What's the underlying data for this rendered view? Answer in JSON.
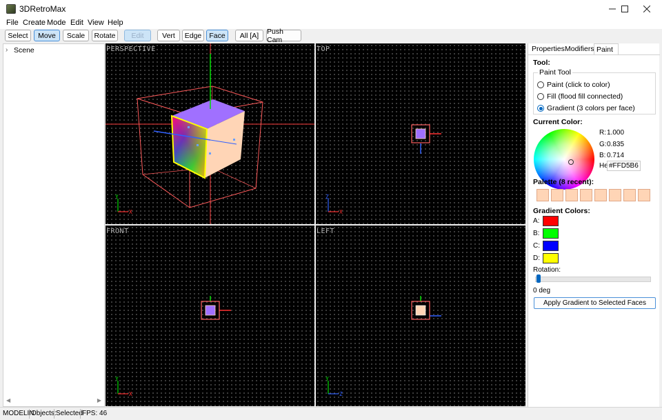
{
  "window": {
    "title": "3DRetroMax"
  },
  "menu": [
    "File",
    "Create",
    "Mode",
    "Edit",
    "View",
    "Help"
  ],
  "toolbar": {
    "select": "Select",
    "move": "Move",
    "scale": "Scale",
    "rotate": "Rotate",
    "edit": "Edit",
    "vert": "Vert",
    "edge": "Edge",
    "face": "Face",
    "all": "All [A]",
    "push_cam": "Push Cam"
  },
  "scene_tree": {
    "root": "Scene"
  },
  "viewports": {
    "perspective": "PERSPECTIVE",
    "top": "TOP",
    "front": "FRONT",
    "left": "LEFT"
  },
  "axes": {
    "x": "X",
    "y": "Y",
    "z": "Z"
  },
  "panel": {
    "tabs": [
      "Properties",
      "Modifiers",
      "Paint"
    ],
    "active_tab": "Paint",
    "tool_heading": "Tool:",
    "paint_tool_group": "Paint Tool",
    "paint_tool_options": [
      {
        "label": "Paint (click to color)",
        "selected": false
      },
      {
        "label": "Fill (flood fill connected)",
        "selected": false
      },
      {
        "label": "Gradient (3 colors per face)",
        "selected": true
      }
    ],
    "current_color_heading": "Current Color:",
    "rgb": {
      "r_label": "R:",
      "r": "1.000",
      "g_label": "G:",
      "g": "0.835",
      "b_label": "B:",
      "b": "0.714",
      "hex_label": "He",
      "hex": "#FFD5B6"
    },
    "palette_heading": "Palette (8 recent):",
    "palette_colors": [
      "#FFD5B6",
      "#FFD5B6",
      "#FFD5B6",
      "#FFD5B6",
      "#FFD5B6",
      "#FFD5B6",
      "#FFD5B6",
      "#FFD5B6"
    ],
    "gradient_heading": "Gradient Colors:",
    "gradient_colors": [
      {
        "label": "A:",
        "color": "#FF0000"
      },
      {
        "label": "B:",
        "color": "#00FF00"
      },
      {
        "label": "C:",
        "color": "#0000FF"
      },
      {
        "label": "D:",
        "color": "#FFFF00"
      }
    ],
    "rotation_label": "Rotation:",
    "rotation_value": "0 deg",
    "apply_button": "Apply Gradient to Selected Faces"
  },
  "status": {
    "mode": "MODELIN",
    "objects": "Objects:",
    "selected": "Selected",
    "fps": "FPS: 46"
  },
  "colors": {
    "accent": "#0067C0",
    "cube_face_top": "#A070FF",
    "cube_face_side": "#FFD5B6",
    "selection_box": "#FF6060"
  }
}
